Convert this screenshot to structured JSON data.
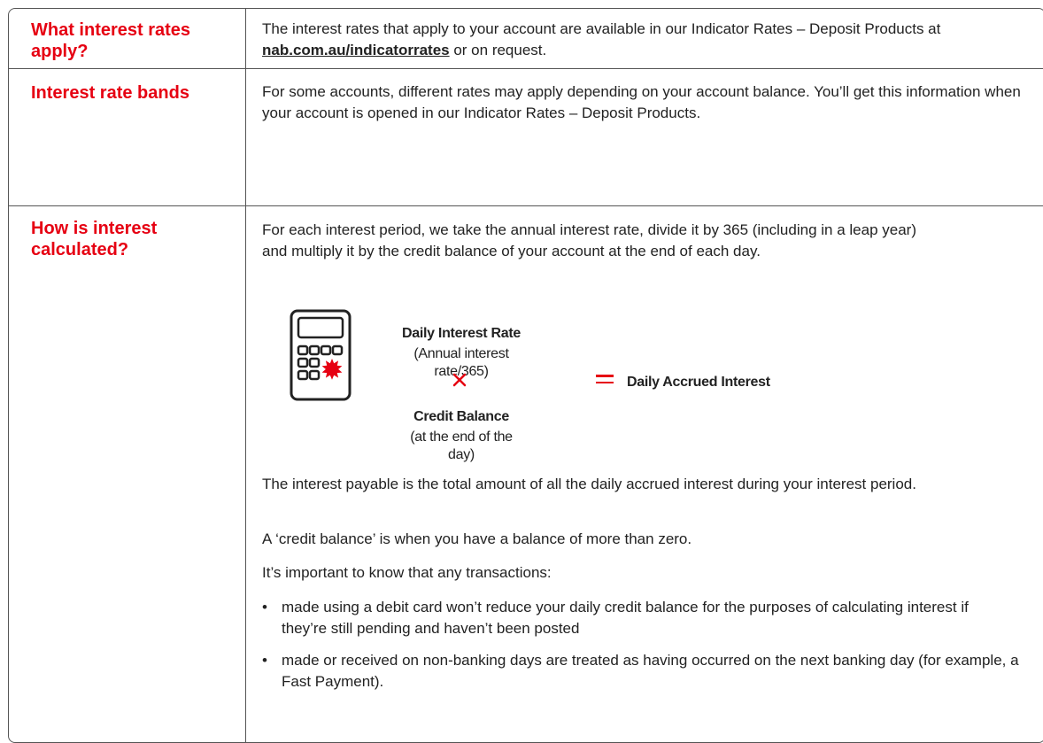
{
  "rows": [
    {
      "heading": "What interest rates apply?",
      "text_before": "The interest rates that apply to your account are available in our Indicator Rates – Deposit Products at ",
      "link_text": "nab.com.au/indicatorrates",
      "text_after": " or on request."
    },
    {
      "heading": "Interest rate bands",
      "text": "For some accounts, different rates may apply depending on your account balance. You’ll get this information when your account is opened in our Indicator Rates – Deposit Products."
    },
    {
      "heading": "How is interest calculated?",
      "intro": "For each interest period, we take the annual interest rate, divide it by 365 (including in a leap year) and multiply it by the credit balance of your account at the end of each day.",
      "formula": {
        "term1_title": "Daily Interest Rate",
        "term1_sub": "(Annual interest rate/365)",
        "term2_title": "Credit Balance",
        "term2_sub": "(at the end of the day)",
        "result": "Daily Accrued Interest"
      },
      "para1": "The interest payable is the total amount of all the daily accrued interest during your interest period.",
      "para2": "A ‘credit balance’ is when you have a balance of more than zero.",
      "para3": "It’s important to know that any transactions:",
      "bullets": [
        "made using a debit card won’t reduce your daily credit balance for the purposes of calculating interest if they’re still pending and haven’t been posted",
        "made or received on non-banking days are treated as having occurred on the next banking day (for example, a Fast Payment)."
      ],
      "bullet_symbol": "•"
    }
  ],
  "colors": {
    "accent": "#e60012",
    "text": "#222222",
    "border": "#555555"
  },
  "icons": [
    "calculator-icon",
    "multiply-icon",
    "equals-icon"
  ]
}
